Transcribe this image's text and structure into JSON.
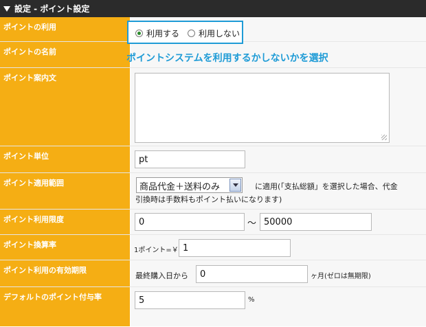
{
  "header": {
    "title": "設定 - ポイント設定"
  },
  "rows": {
    "use": {
      "label": "ポイントの利用",
      "options": [
        "利用する",
        "利用しない"
      ],
      "selected": "利用する"
    },
    "name": {
      "label": "ポイントの名前",
      "annotation": "ポイントシステムを利用するかしないかを選択"
    },
    "guide": {
      "label": "ポイント案内文",
      "value": ""
    },
    "unit": {
      "label": "ポイント単位",
      "value": "pt"
    },
    "scope": {
      "label": "ポイント適用範囲",
      "selected": "商品代金＋送料のみ",
      "note_line1": "に適用(「支払総額」を選択した場合、代金",
      "note_line2": "引換時は手数料もポイント払いになります)"
    },
    "limit": {
      "label": "ポイント利用限度",
      "min": "0",
      "sep": "～",
      "max": "50000"
    },
    "rate": {
      "label": "ポイント換算率",
      "prefix": "1ポイント=￥",
      "value": "1"
    },
    "expiry": {
      "label": "ポイント利用の有効期限",
      "prefix": "最終購入日から",
      "value": "0",
      "suffix": "ヶ月(ゼロは無期限)"
    },
    "grant": {
      "label": "デフォルトのポイント付与率",
      "value": "5",
      "suffix": "%"
    }
  }
}
